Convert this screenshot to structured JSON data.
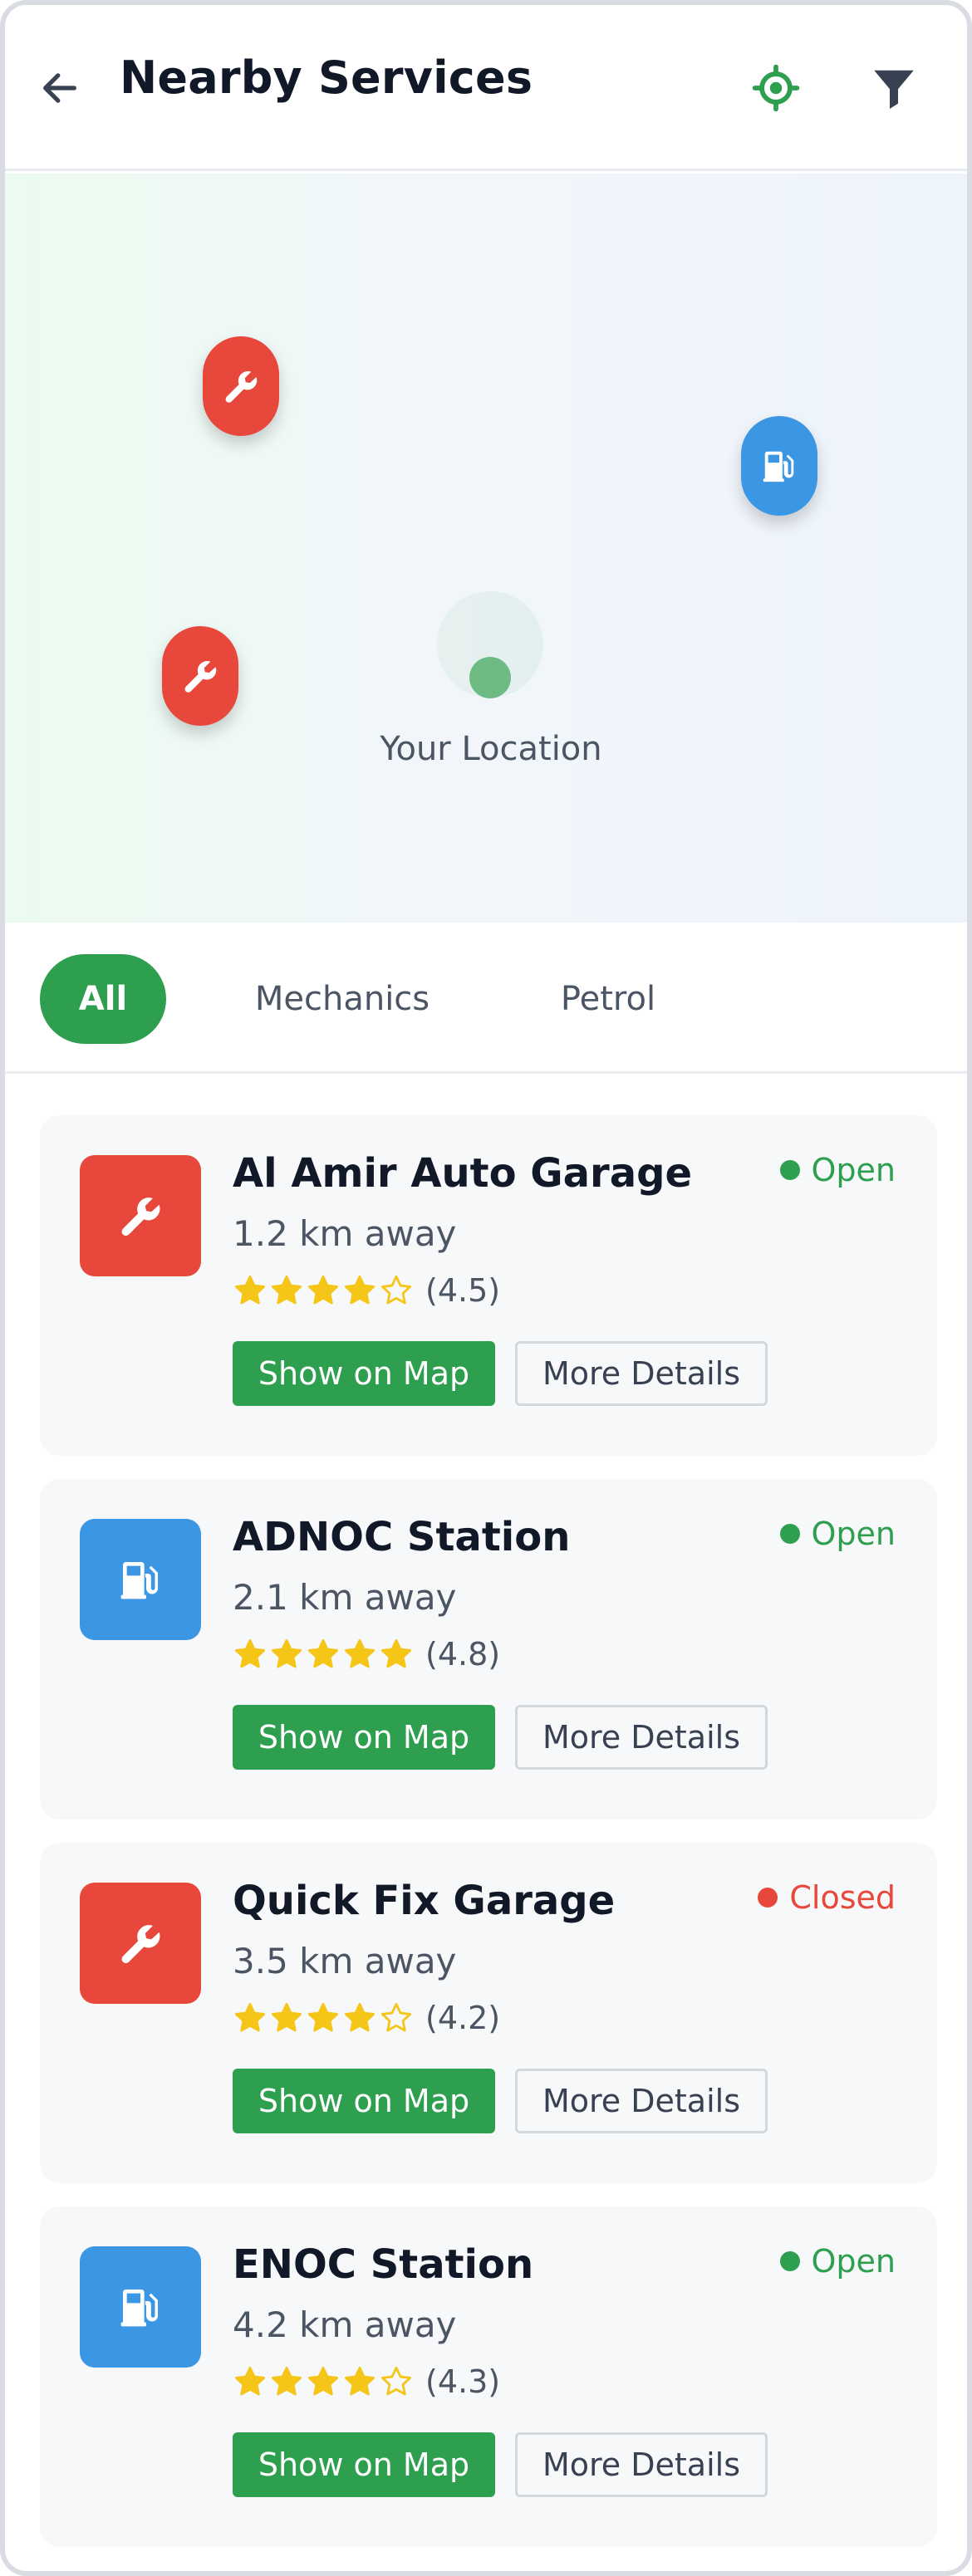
{
  "header": {
    "title": "Nearby Services",
    "back_icon": "arrow-left-icon",
    "locate_icon": "crosshair-icon",
    "filter_icon": "filter-icon"
  },
  "map": {
    "you_label": "Your Location",
    "pins": [
      {
        "kind": "mechanic",
        "icon": "wrench-icon",
        "color": "#e8483c"
      },
      {
        "kind": "petrol",
        "icon": "fuel-pump-icon",
        "color": "#3b97e3"
      },
      {
        "kind": "mechanic",
        "icon": "wrench-icon",
        "color": "#e8483c"
      }
    ]
  },
  "tabs": [
    {
      "label": "All",
      "active": true
    },
    {
      "label": "Mechanics",
      "active": false
    },
    {
      "label": "Petrol",
      "active": false
    }
  ],
  "colors": {
    "primary": "#2e9e4f",
    "mechanic": "#e8483c",
    "petrol": "#3b97e3",
    "star": "#f5c518",
    "open": "#2e9e4f",
    "closed": "#e8483c"
  },
  "services": [
    {
      "name": "Al Amir Auto Garage",
      "distance": "1.2 km away",
      "rating": 4.5,
      "rating_label": "(4.5)",
      "filled_stars": 4,
      "status": "Open",
      "type": "mechanic",
      "icon": "wrench-icon",
      "map_btn": "Show on Map",
      "details_btn": "More Details"
    },
    {
      "name": "ADNOC Station",
      "distance": "2.1 km away",
      "rating": 4.8,
      "rating_label": "(4.8)",
      "filled_stars": 5,
      "status": "Open",
      "type": "petrol",
      "icon": "fuel-pump-icon",
      "map_btn": "Show on Map",
      "details_btn": "More Details"
    },
    {
      "name": "Quick Fix Garage",
      "distance": "3.5 km away",
      "rating": 4.2,
      "rating_label": "(4.2)",
      "filled_stars": 4,
      "status": "Closed",
      "type": "mechanic",
      "icon": "wrench-icon",
      "map_btn": "Show on Map",
      "details_btn": "More Details"
    },
    {
      "name": "ENOC Station",
      "distance": "4.2 km away",
      "rating": 4.3,
      "rating_label": "(4.3)",
      "filled_stars": 4,
      "status": "Open",
      "type": "petrol",
      "icon": "fuel-pump-icon",
      "map_btn": "Show on Map",
      "details_btn": "More Details"
    }
  ]
}
